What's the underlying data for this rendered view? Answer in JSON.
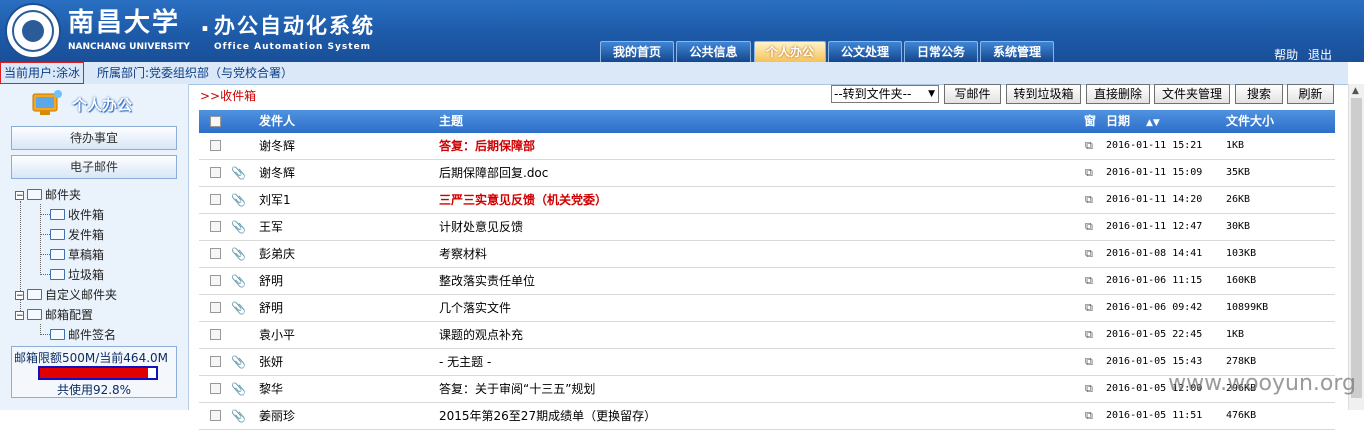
{
  "header": {
    "university_cn": "南昌大学",
    "system_cn": "办公自动化系统",
    "university_en": "NANCHANG UNIVERSITY",
    "system_en": "Office Automation System",
    "nav_tabs": [
      {
        "label": "我的首页",
        "active": false
      },
      {
        "label": "公共信息",
        "active": false
      },
      {
        "label": "个人办公",
        "active": true
      },
      {
        "label": "公文处理",
        "active": false
      },
      {
        "label": "日常公务",
        "active": false
      },
      {
        "label": "系统管理",
        "active": false
      }
    ],
    "help_label": "帮助",
    "logout_label": "退出"
  },
  "user_bar": {
    "current_user": "当前用户:涂冰",
    "department": "所属部门:党委组织部（与党校合署）"
  },
  "sidebar": {
    "title": "个人办公",
    "buttons": [
      "待办事宜",
      "电子邮件"
    ],
    "tree": {
      "mailbox": "邮件夹",
      "inbox": "收件箱",
      "sent": "发件箱",
      "drafts": "草稿箱",
      "trash": "垃圾箱",
      "custom": "自定义邮件夹",
      "config": "邮箱配置",
      "signature": "邮件签名"
    },
    "quota": {
      "text": "邮箱限额500M/当前464.0M",
      "used_label": "共使用92.8%",
      "used_fraction": 0.928
    }
  },
  "main": {
    "breadcrumb": ">>收件箱",
    "move_select": "--转到文件夹--",
    "buttons": [
      "写邮件",
      "转到垃圾箱",
      "直接删除",
      "文件夹管理",
      "搜索",
      "刷新"
    ],
    "columns": {
      "sender": "发件人",
      "subject": "主题",
      "window": "窗",
      "date": "日期",
      "size": "文件大小"
    },
    "rows": [
      {
        "attach": false,
        "sender": "谢冬辉",
        "subject": "答复：后期保障部",
        "highlight": true,
        "date": "2016-01-11 15:21",
        "size": "1KB"
      },
      {
        "attach": true,
        "sender": "谢冬辉",
        "subject": "后期保障部回复.doc",
        "highlight": false,
        "date": "2016-01-11 15:09",
        "size": "35KB"
      },
      {
        "attach": true,
        "sender": "刘军1",
        "subject": "三严三实意见反馈（机关党委）",
        "highlight": true,
        "date": "2016-01-11 14:20",
        "size": "26KB"
      },
      {
        "attach": true,
        "sender": "王军",
        "subject": "计财处意见反馈",
        "highlight": false,
        "date": "2016-01-11 12:47",
        "size": "30KB"
      },
      {
        "attach": true,
        "sender": "彭弟庆",
        "subject": "考察材料",
        "highlight": false,
        "date": "2016-01-08 14:41",
        "size": "103KB"
      },
      {
        "attach": true,
        "sender": "舒明",
        "subject": "整改落实责任单位",
        "highlight": false,
        "date": "2016-01-06 11:15",
        "size": "160KB"
      },
      {
        "attach": true,
        "sender": "舒明",
        "subject": "几个落实文件",
        "highlight": false,
        "date": "2016-01-06 09:42",
        "size": "10899KB"
      },
      {
        "attach": false,
        "sender": "袁小平",
        "subject": "课题的观点补充",
        "highlight": false,
        "date": "2016-01-05 22:45",
        "size": "1KB"
      },
      {
        "attach": true,
        "sender": "张妍",
        "subject": "- 无主题 -",
        "highlight": false,
        "date": "2016-01-05 15:43",
        "size": "278KB"
      },
      {
        "attach": true,
        "sender": "黎华",
        "subject": "答复：关于审阅“十三五”规划",
        "highlight": false,
        "date": "2016-01-05 12:00",
        "size": "296KB"
      },
      {
        "attach": true,
        "sender": "姜丽珍",
        "subject": "2015年第26至27期成绩单（更换留存）",
        "highlight": false,
        "date": "2016-01-05 11:51",
        "size": "476KB"
      }
    ]
  },
  "watermark": "www.wooyun.org",
  "colors": {
    "header_blue": "#1d5aa8",
    "highlight_red": "#d00000",
    "quota_fill": "#e00000",
    "quota_border": "#1010c0"
  }
}
